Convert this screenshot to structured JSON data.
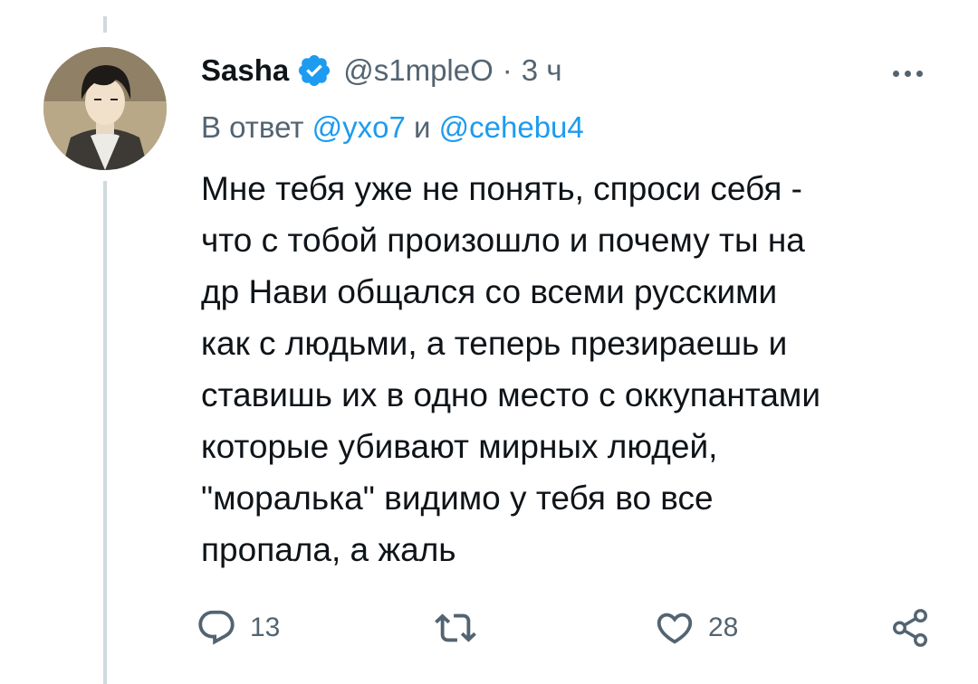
{
  "tweet": {
    "author": {
      "display_name": "Sasha",
      "handle": "@s1mpleO",
      "verified": true,
      "avatar_icon": "anime-character-avatar"
    },
    "separator": "·",
    "timestamp": "3 ч",
    "reply_to": {
      "prefix": "В ответ",
      "mention_1": "@yxo7",
      "conjunction": "и",
      "mention_2": "@cehebu4"
    },
    "text_lines": [
      "Мне тебя уже не понять, спроси себя -",
      "что с тобой произошло и почему ты на",
      "др Нави общался со всеми русскими",
      "как с людьми, а теперь презираешь и",
      "ставишь их в одно место с оккупантами",
      "которые убивают мирных людей,",
      "\"моралька\" видимо у тебя во все",
      "пропала, а жаль"
    ],
    "actions": {
      "reply_count": "13",
      "retweet_count": "",
      "like_count": "28"
    },
    "icons": {
      "verified": "verified-badge-icon",
      "more": "more-icon",
      "reply": "reply-icon",
      "retweet": "retweet-icon",
      "like": "heart-icon",
      "share": "share-icon"
    },
    "colors": {
      "accent": "#1d9bf0",
      "text": "#0f1419",
      "secondary": "#536471",
      "thread_line": "#cfd9de"
    }
  }
}
